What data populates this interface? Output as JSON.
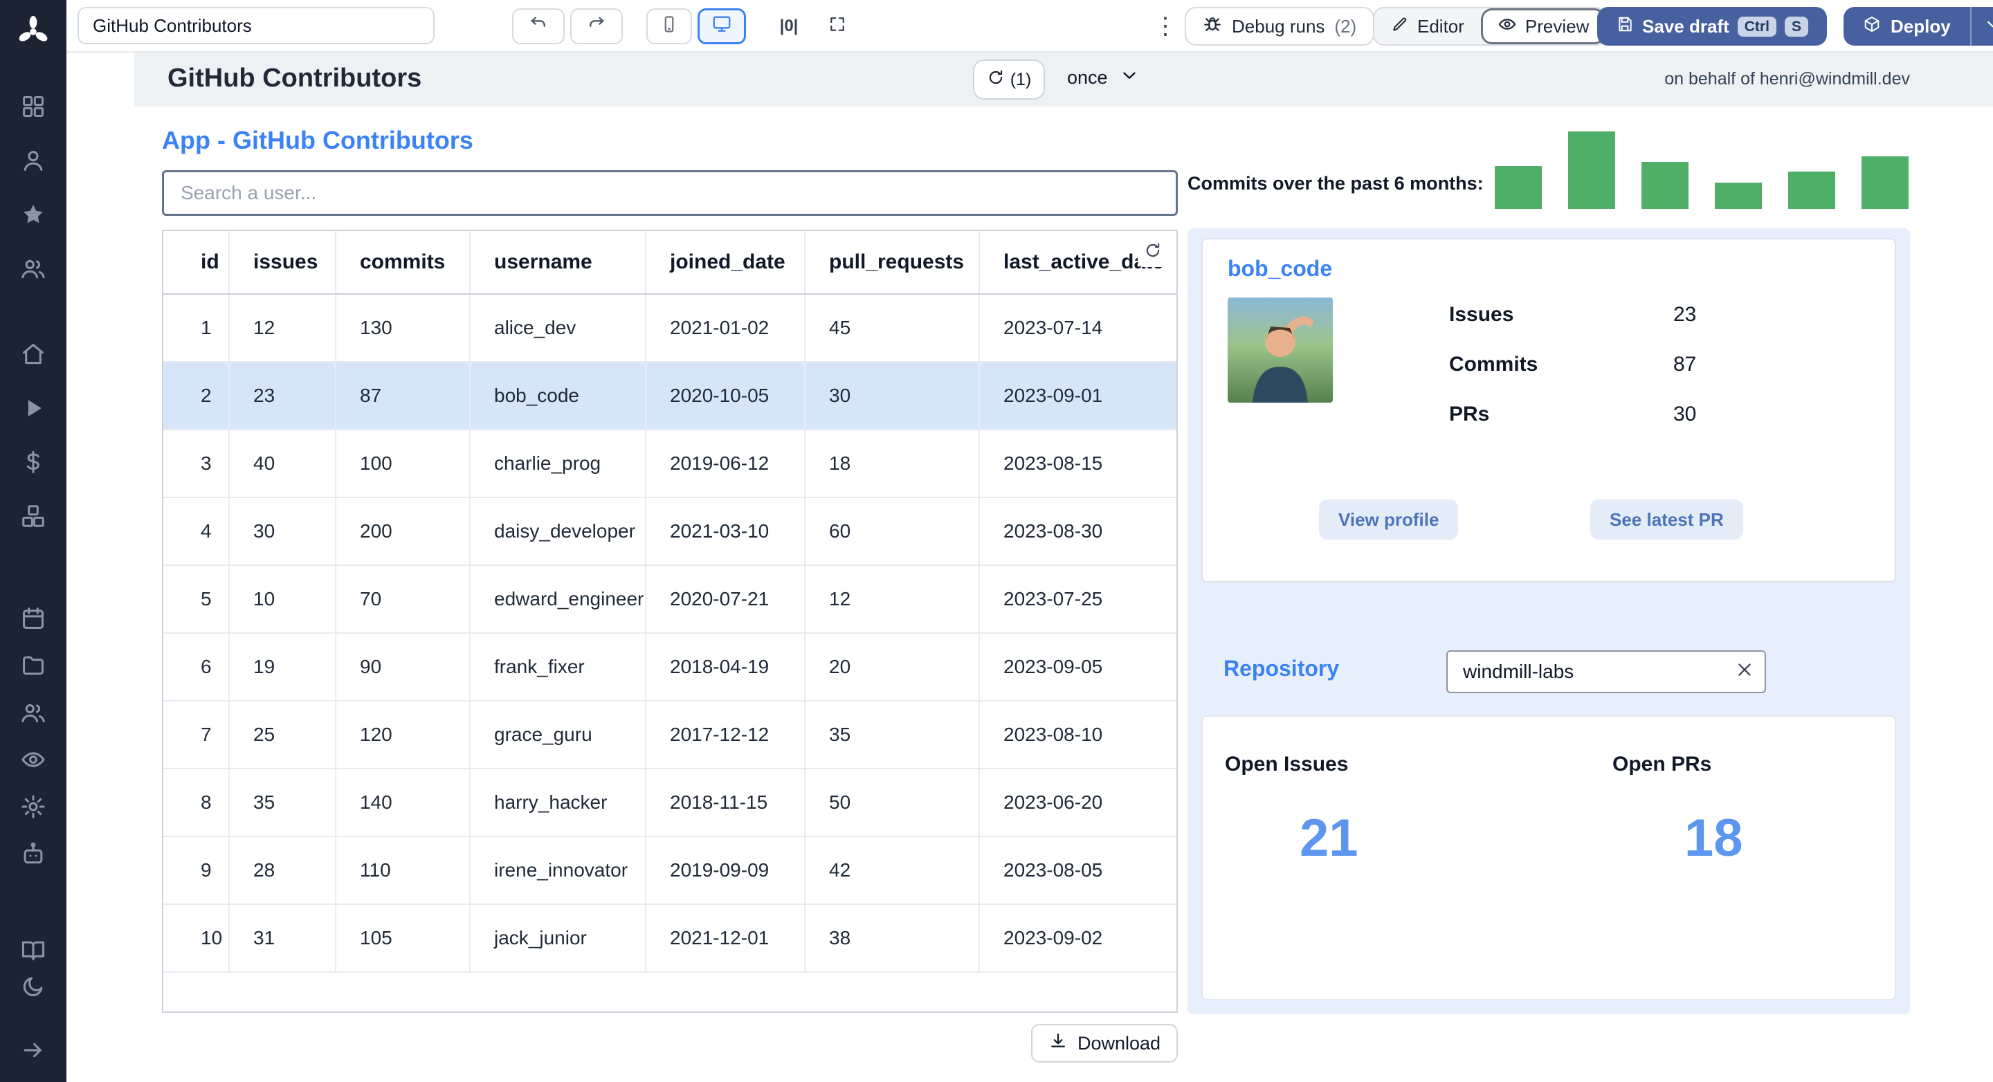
{
  "topbar": {
    "app_name": "GitHub Contributors",
    "debug_runs_label": "Debug runs",
    "debug_runs_count": "(2)",
    "editor_label": "Editor",
    "preview_label": "Preview",
    "save_draft_label": "Save draft",
    "save_shortcut_keys": [
      "Ctrl",
      "S"
    ],
    "deploy_label": "Deploy"
  },
  "header": {
    "title": "GitHub Contributors",
    "refresh_count": "(1)",
    "schedule_value": "once",
    "on_behalf_of": "on behalf of henri@windmill.dev"
  },
  "app": {
    "title": "App - GitHub Contributors",
    "search_placeholder": "Search a user...",
    "download_label": "Download"
  },
  "table": {
    "columns": [
      "id",
      "issues",
      "commits",
      "username",
      "joined_date",
      "pull_requests",
      "last_active_date"
    ],
    "rows": [
      [
        "1",
        "12",
        "130",
        "alice_dev",
        "2021-01-02",
        "45",
        "2023-07-14"
      ],
      [
        "2",
        "23",
        "87",
        "bob_code",
        "2020-10-05",
        "30",
        "2023-09-01"
      ],
      [
        "3",
        "40",
        "100",
        "charlie_prog",
        "2019-06-12",
        "18",
        "2023-08-15"
      ],
      [
        "4",
        "30",
        "200",
        "daisy_developer",
        "2021-03-10",
        "60",
        "2023-08-30"
      ],
      [
        "5",
        "10",
        "70",
        "edward_engineer",
        "2020-07-21",
        "12",
        "2023-07-25"
      ],
      [
        "6",
        "19",
        "90",
        "frank_fixer",
        "2018-04-19",
        "20",
        "2023-09-05"
      ],
      [
        "7",
        "25",
        "120",
        "grace_guru",
        "2017-12-12",
        "35",
        "2023-08-10"
      ],
      [
        "8",
        "35",
        "140",
        "harry_hacker",
        "2018-11-15",
        "50",
        "2023-06-20"
      ],
      [
        "9",
        "28",
        "110",
        "irene_innovator",
        "2019-09-09",
        "42",
        "2023-08-05"
      ],
      [
        "10",
        "31",
        "105",
        "jack_junior",
        "2021-12-01",
        "38",
        "2023-09-02"
      ]
    ],
    "selected_row": 1
  },
  "user_card": {
    "username": "bob_code",
    "stats": [
      {
        "label": "Issues",
        "value": "23"
      },
      {
        "label": "Commits",
        "value": "87"
      },
      {
        "label": "PRs",
        "value": "30"
      }
    ],
    "view_profile_label": "View profile",
    "see_latest_pr_label": "See latest PR"
  },
  "repository": {
    "title": "Repository",
    "input_value": "windmill-labs",
    "stats": [
      {
        "label": "Open Issues",
        "value": "21"
      },
      {
        "label": "Open PRs",
        "value": "18"
      }
    ]
  },
  "chart_data": {
    "type": "bar",
    "title": "Commits over the past 6 months:",
    "values": [
      31,
      56,
      34,
      19,
      27,
      38
    ],
    "color": "#4fae68",
    "x_axis_labels_visible": false,
    "legend": "none"
  },
  "sidebar": {
    "groups": [
      [
        {
          "name": "apps",
          "icon": "grid"
        },
        {
          "name": "account",
          "icon": "user"
        },
        {
          "name": "favorites",
          "icon": "star"
        },
        {
          "name": "collaborators",
          "icon": "users"
        }
      ],
      [
        {
          "name": "home",
          "icon": "home"
        },
        {
          "name": "runs",
          "icon": "play"
        },
        {
          "name": "usage",
          "icon": "dollar"
        },
        {
          "name": "resources",
          "icon": "boxes"
        }
      ],
      [
        {
          "name": "schedules",
          "icon": "calendar"
        },
        {
          "name": "folders",
          "icon": "folder"
        },
        {
          "name": "groups",
          "icon": "users"
        },
        {
          "name": "audit-logs",
          "icon": "eye"
        },
        {
          "name": "settings",
          "icon": "gear"
        },
        {
          "name": "workers",
          "icon": "bot"
        }
      ]
    ],
    "bottom": [
      {
        "name": "docs",
        "icon": "book"
      },
      {
        "name": "theme-toggle",
        "icon": "moon"
      },
      {
        "name": "expand-sidebar",
        "icon": "arrow-right"
      }
    ]
  },
  "colors": {
    "accent_blue": "#3b82f6",
    "primary_button_blue": "#47609f",
    "bar_green": "#4fae68",
    "selected_row_blue": "#d7e5f8",
    "panel_blue": "#e7effc",
    "stat_number_blue": "#5d96ee",
    "sidebar_dark": "#1c2434"
  }
}
